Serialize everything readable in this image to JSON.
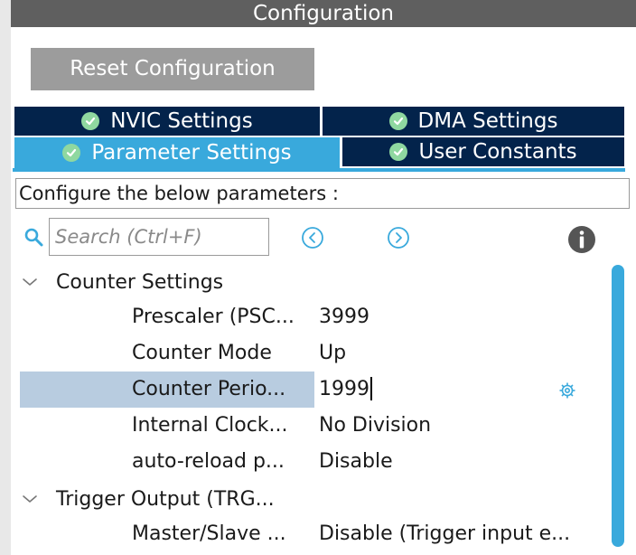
{
  "window": {
    "title": "Configuration"
  },
  "toolbar": {
    "reset_label": "Reset Configuration"
  },
  "tabs": [
    {
      "label": "NVIC Settings",
      "icon": "check-circle-icon",
      "active": false
    },
    {
      "label": "DMA Settings",
      "icon": "check-circle-icon",
      "active": false
    },
    {
      "label": "Parameter Settings",
      "icon": "check-circle-icon",
      "active": true
    },
    {
      "label": "User Constants",
      "icon": "check-circle-icon",
      "active": false
    }
  ],
  "description": "Configure the below parameters :",
  "search": {
    "placeholder": "Search (Ctrl+F)",
    "value": ""
  },
  "groups": [
    {
      "label": "Counter Settings",
      "expanded": true,
      "params": [
        {
          "name": "Prescaler (PSC...",
          "value": "3999"
        },
        {
          "name": "Counter Mode",
          "value": "Up"
        },
        {
          "name": "Counter Perio...",
          "value": "1999",
          "selected": true,
          "editing": true
        },
        {
          "name": "Internal Clock...",
          "value": "No Division"
        },
        {
          "name": "auto-reload p...",
          "value": "Disable"
        }
      ]
    },
    {
      "label": "Trigger Output (TRG...",
      "expanded": true,
      "params": [
        {
          "name": "Master/Slave ...",
          "value": "Disable (Trigger input e..."
        }
      ]
    }
  ],
  "colors": {
    "title_bar": "#5f5f5f",
    "tab_inactive": "#03234b",
    "tab_active": "#39a9dc",
    "selection": "#b8cce0",
    "accent": "#39a9dc",
    "check": "#8fd8a0"
  }
}
